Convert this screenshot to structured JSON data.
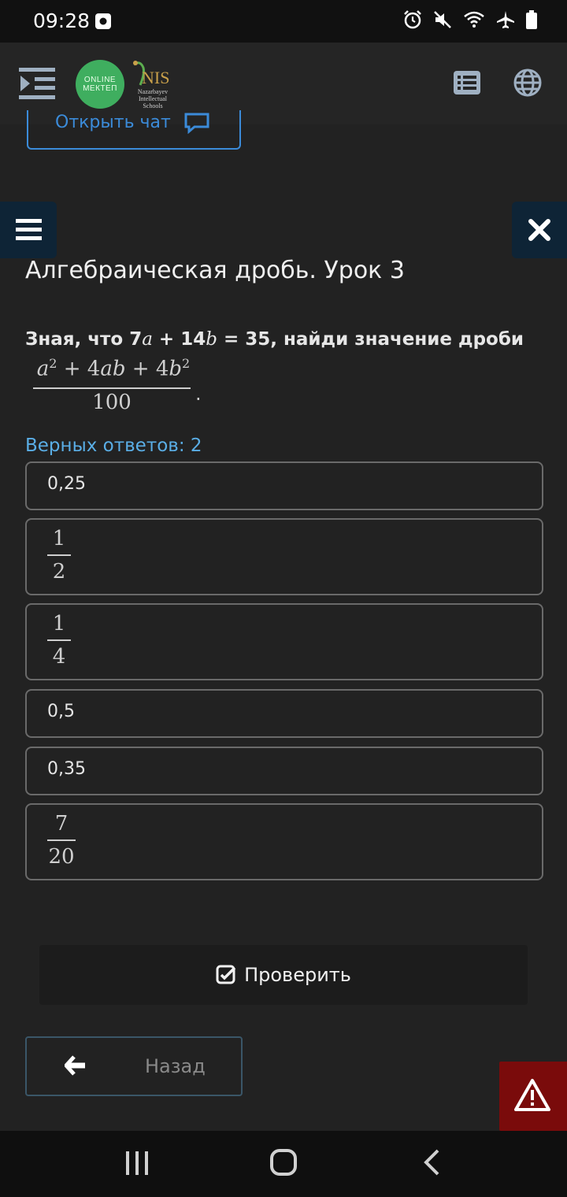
{
  "status_bar": {
    "time": "09:28",
    "icons": [
      "photo-icon",
      "alarm-icon",
      "mute-icon",
      "wifi-icon",
      "airplane-icon",
      "battery-icon"
    ]
  },
  "header": {
    "logo_online": [
      "ONLINE",
      "МЕКТЕП"
    ],
    "logo_nis": "NIS",
    "logo_nis_sub": [
      "Nazarbayev",
      "Intellectual",
      "Schools"
    ]
  },
  "chat": {
    "label": "Открыть чат"
  },
  "page": {
    "title": "Алгебраическая дробь. Урок 3",
    "question_prefix": "Зная, что 7",
    "var_a": "a",
    "question_mid": " + 14",
    "var_b": "b",
    "question_suffix": " = 35, найди значение дроби",
    "fraction_num_a": "a",
    "fraction_num_exp1": "2",
    "fraction_num_middle": " + 4",
    "fraction_num_ab": "ab",
    "fraction_num_plus": " + 4",
    "fraction_num_b": "b",
    "fraction_num_exp2": "2",
    "fraction_den": "100",
    "fraction_end": ".",
    "correct_count": "Верных ответов: 2"
  },
  "options": [
    {
      "type": "text",
      "value": "0,25"
    },
    {
      "type": "fraction",
      "num": "1",
      "den": "2"
    },
    {
      "type": "fraction",
      "num": "1",
      "den": "4"
    },
    {
      "type": "text",
      "value": "0,5"
    },
    {
      "type": "text",
      "value": "0,35"
    },
    {
      "type": "fraction",
      "num": "7",
      "den": "20"
    }
  ],
  "actions": {
    "check_label": "Проверить",
    "back_label": "Назад"
  },
  "colors": {
    "background": "#222222",
    "accent_blue": "#3b8bd9",
    "correct_text": "#5aaee6",
    "warning": "#7a0b0b",
    "nav_panel": "#0e2436"
  }
}
